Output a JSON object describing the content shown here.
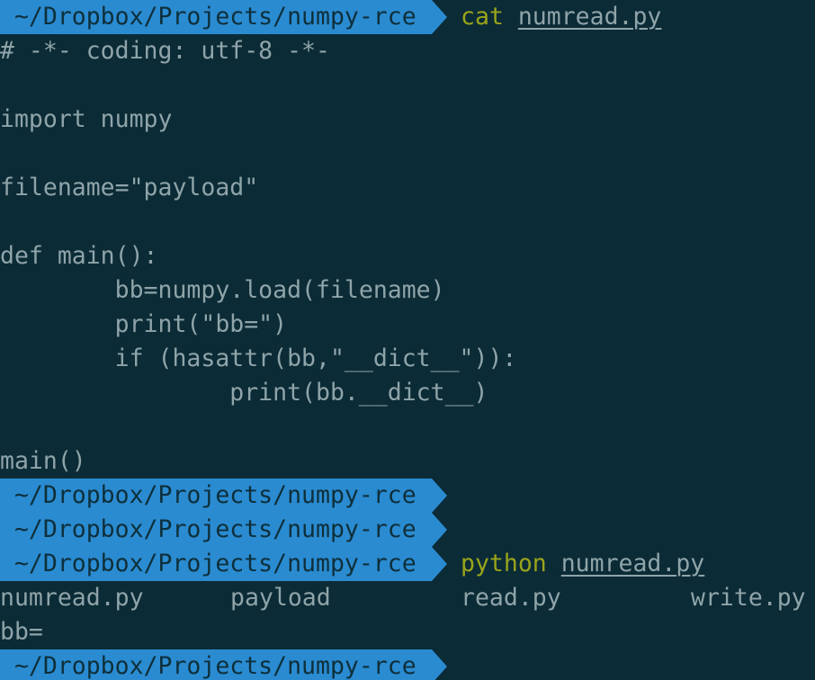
{
  "prompt_path": " ~/Dropbox/Projects/numpy-rce",
  "first_command": {
    "cmd": "cat",
    "arg": "numread.py"
  },
  "file_lines": [
    "# -*- coding: utf-8 -*-",
    "",
    "import numpy",
    "",
    "filename=\"payload\"",
    "",
    "def main():",
    "        bb=numpy.load(filename)",
    "        print(\"bb=\")",
    "        if (hasattr(bb,\"__dict__\")):",
    "                print(bb.__dict__)",
    "",
    "main()"
  ],
  "second_command": {
    "cmd": "python",
    "arg": "numread.py"
  },
  "ls_output": [
    "numread.py",
    "payload",
    "read.py",
    "write.py"
  ],
  "program_output": "bb=",
  "colors": {
    "background": "#0b2b36",
    "prompt_bg": "#2a8bd1",
    "command": "#9aa41b",
    "text": "#8fa4a9"
  }
}
